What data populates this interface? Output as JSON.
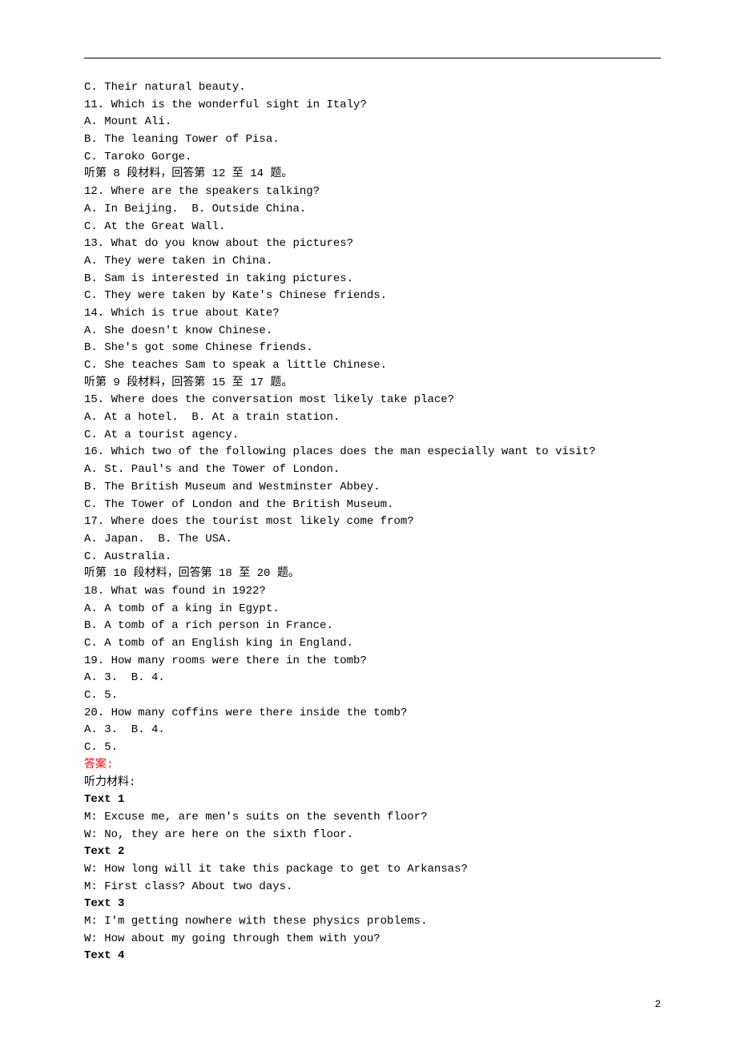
{
  "lines": [
    {
      "text": "C. Their natural beauty."
    },
    {
      "text": "11. Which is the wonderful sight in Italy?"
    },
    {
      "text": "A. Mount Ali."
    },
    {
      "text": "B. The leaning Tower of Pisa."
    },
    {
      "text": "C. Taroko Gorge."
    },
    {
      "text": "听第 8 段材料，回答第 12 至 14 题。"
    },
    {
      "text": "12. Where are the speakers talking?"
    },
    {
      "text": "A. In Beijing.  B. Outside China."
    },
    {
      "text": "C. At the Great Wall."
    },
    {
      "text": "13. What do you know about the pictures?"
    },
    {
      "text": "A. They were taken in China."
    },
    {
      "text": "B. Sam is interested in taking pictures."
    },
    {
      "text": "C. They were taken by Kate's Chinese friends."
    },
    {
      "text": "14. Which is true about Kate?"
    },
    {
      "text": "A. She doesn't know Chinese."
    },
    {
      "text": "B. She's got some Chinese friends."
    },
    {
      "text": "C. She teaches Sam to speak a little Chinese."
    },
    {
      "text": "听第 9 段材料，回答第 15 至 17 题。"
    },
    {
      "text": "15. Where does the conversation most likely take place?"
    },
    {
      "text": "A. At a hotel.  B. At a train station."
    },
    {
      "text": "C. At a tourist agency."
    },
    {
      "text": "16. Which two of the following places does the man especially want to visit?"
    },
    {
      "text": "A. St. Paul's and the Tower of London."
    },
    {
      "text": "B. The British Museum and Westminster Abbey."
    },
    {
      "text": "C. The Tower of London and the British Museum."
    },
    {
      "text": "17. Where does the tourist most likely come from?"
    },
    {
      "text": "A. Japan.  B. The USA."
    },
    {
      "text": "C. Australia."
    },
    {
      "text": "听第 10 段材料，回答第 18 至 20 题。"
    },
    {
      "text": "18. What was found in 1922?"
    },
    {
      "text": "A. A tomb of a king in Egypt."
    },
    {
      "text": "B. A tomb of a rich person in France."
    },
    {
      "text": "C. A tomb of an English king in England."
    },
    {
      "text": "19. How many rooms were there in the tomb?"
    },
    {
      "text": "A. 3.  B. 4."
    },
    {
      "text": "C. 5."
    },
    {
      "text": "20. How many coffins were there inside the tomb?"
    },
    {
      "text": "A. 3.  B. 4."
    },
    {
      "text": "C. 5."
    },
    {
      "text": "答案:",
      "cls": "red"
    },
    {
      "text": "听力材料:"
    },
    {
      "text": "Text 1",
      "cls": "bold"
    },
    {
      "text": "M: Excuse me, are men's suits on the seventh floor?"
    },
    {
      "text": "W: No, they are here on the sixth floor."
    },
    {
      "text": "Text 2",
      "cls": "bold"
    },
    {
      "text": "W: How long will it take this package to get to Arkansas?"
    },
    {
      "text": "M: First class? About two days."
    },
    {
      "text": "Text 3",
      "cls": "bold"
    },
    {
      "text": "M: I'm getting nowhere with these physics problems."
    },
    {
      "text": "W: How about my going through them with you?"
    },
    {
      "text": "Text 4",
      "cls": "bold"
    }
  ],
  "pageNumber": "2"
}
